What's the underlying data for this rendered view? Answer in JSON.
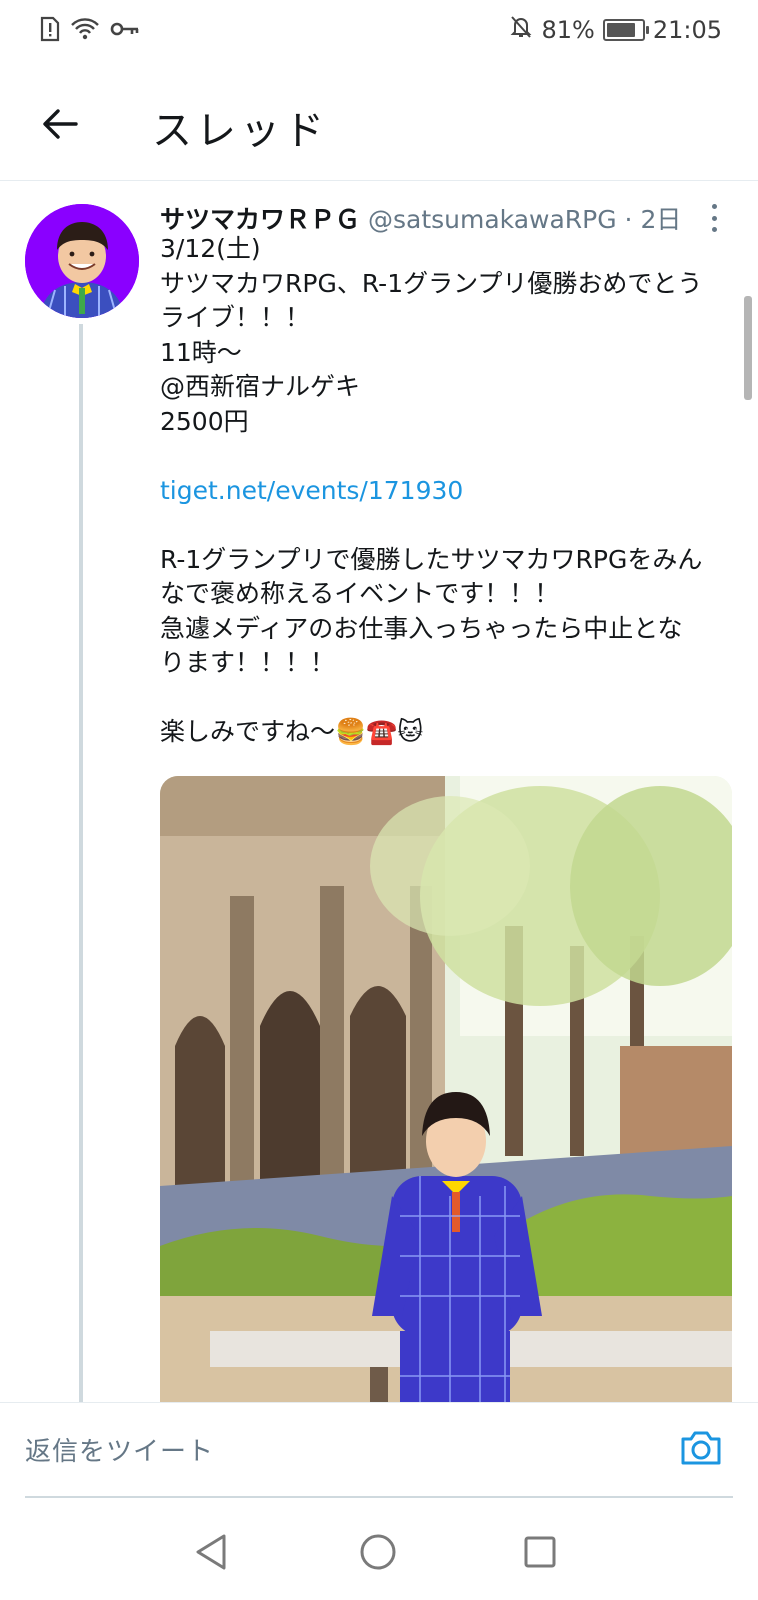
{
  "status_bar": {
    "battery_percent": "81%",
    "battery_level": 0.81,
    "time": "21:05",
    "icons": [
      "alert-sim-icon",
      "wifi-icon",
      "vpn-key-icon",
      "mute-icon",
      "battery-icon"
    ]
  },
  "header": {
    "title": "スレッド",
    "back_icon": "arrow-left-icon"
  },
  "tweet": {
    "author_name": "サツマカワＲＰＧ",
    "handle_time": "@satsumakawaRPG · 2日",
    "lines": [
      "3/12(土)",
      "サツマカワRPG、R-1グランプリ優勝おめでとう",
      "ライブ！！！",
      "11時〜",
      "@西新宿ナルゲキ",
      "2500円",
      "",
      "",
      "",
      "R-1グランプリで優勝したサツマカワRPGをみん",
      "なで褒め称えるイベントです！！！",
      "急遽メディアのお仕事入っちゃったら中止とな",
      "ります！！！！",
      "",
      "楽しみですね〜🍔☎️🐱"
    ],
    "link": "tiget.net/events/171930",
    "more_icon": "more-vertical-icon"
  },
  "reply": {
    "placeholder": "返信をツイート",
    "camera_icon": "camera-icon"
  },
  "nav": {
    "icons": [
      "back-triangle-icon",
      "home-circle-icon",
      "recents-square-icon"
    ]
  },
  "colors": {
    "link": "#1b95e0",
    "secondary_text": "#657786",
    "avatar_bg": "#8a00ff",
    "divider": "#cfd9de"
  }
}
